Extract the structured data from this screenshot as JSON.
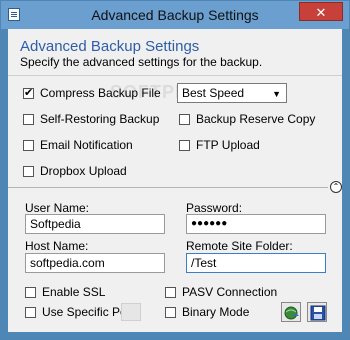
{
  "window": {
    "title": "Advanced Backup Settings",
    "close_glyph": "✕"
  },
  "header": {
    "heading": "Advanced Backup Settings",
    "subheading": "Specify the advanced settings for the backup."
  },
  "watermark": "SOFTPEDIA",
  "options": {
    "compress": {
      "label": "Compress Backup File",
      "checked": true
    },
    "speed_select": {
      "value": "Best Speed"
    },
    "self_restoring": {
      "label": "Self-Restoring Backup",
      "checked": false
    },
    "reserve_copy": {
      "label": "Backup Reserve Copy",
      "checked": false
    },
    "email": {
      "label": "Email Notification",
      "checked": false
    },
    "ftp": {
      "label": "FTP Upload",
      "checked": false
    },
    "dropbox": {
      "label": "Dropbox Upload",
      "checked": false
    }
  },
  "ftp_panel": {
    "collapse_glyph": "⌃",
    "username_label": "User Name:",
    "username_value": "Softpedia",
    "password_label": "Password:",
    "password_value": "●●●●●●",
    "hostname_label": "Host Name:",
    "hostname_value": "softpedia.com",
    "folder_label": "Remote Site Folder:",
    "folder_value": "/Test",
    "enable_ssl": {
      "label": "Enable SSL",
      "checked": false
    },
    "pasv": {
      "label": "PASV Connection",
      "checked": false
    },
    "specific_port": {
      "label": "Use Specific Port",
      "checked": false
    },
    "binary": {
      "label": "Binary Mode",
      "checked": false
    }
  },
  "icons": {
    "test_connection": "globe-arrow-icon",
    "save": "floppy-disk-icon"
  }
}
